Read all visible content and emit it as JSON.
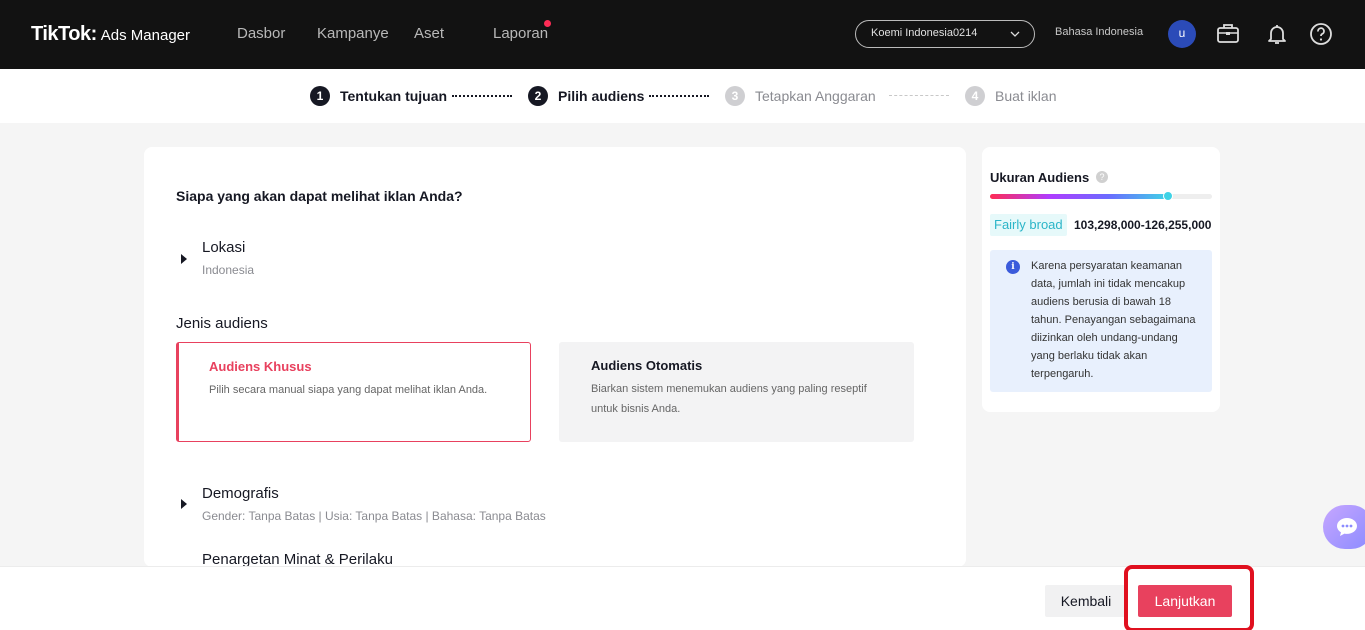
{
  "header": {
    "logo_main": "TikTok:",
    "logo_sub": "Ads Manager",
    "nav": [
      {
        "label": "Dasbor"
      },
      {
        "label": "Kampanye"
      },
      {
        "label": "Aset"
      },
      {
        "label": "Laporan"
      }
    ],
    "account": "Koemi Indonesia0214",
    "language": "Bahasa Indonesia",
    "avatar_initial": "u",
    "icons": [
      "briefcase-icon",
      "bell-icon",
      "help-icon"
    ]
  },
  "stepper": {
    "steps": [
      {
        "num": "1",
        "label": "Tentukan tujuan",
        "state": "done"
      },
      {
        "num": "2",
        "label": "Pilih audiens",
        "state": "active"
      },
      {
        "num": "3",
        "label": "Tetapkan Anggaran",
        "state": "inactive"
      },
      {
        "num": "4",
        "label": "Buat iklan",
        "state": "inactive"
      }
    ]
  },
  "main": {
    "question": "Siapa yang akan dapat melihat iklan Anda?",
    "lokasi": {
      "title": "Lokasi",
      "value": "Indonesia"
    },
    "jenis_label": "Jenis audiens",
    "custom": {
      "title": "Audiens Khusus",
      "desc": "Pilih secara manual siapa yang dapat melihat iklan Anda."
    },
    "auto": {
      "title": "Audiens Otomatis",
      "desc": "Biarkan sistem menemukan audiens yang paling reseptif untuk bisnis Anda."
    },
    "demografis": {
      "title": "Demografis",
      "value": "Gender: Tanpa Batas | Usia: Tanpa Batas | Bahasa: Tanpa Batas"
    },
    "minat": {
      "title": "Penargetan Minat & Perilaku"
    }
  },
  "side": {
    "title": "Ukuran Audiens",
    "gauge_level": 0.8,
    "breadth": "Fairly broad",
    "range": "103,298,000-126,255,000",
    "info": "Karena persyaratan keamanan data, jumlah ini tidak mencakup audiens berusia di bawah 18 tahun. Penayangan sebagaimana diizinkan oleh undang-undang yang berlaku tidak akan terpengaruh."
  },
  "footer": {
    "back_label": "Kembali",
    "next_label": "Lanjutkan"
  },
  "colors": {
    "accent": "#e8415e",
    "highlight": "#e0101f",
    "topbar": "#121212"
  }
}
